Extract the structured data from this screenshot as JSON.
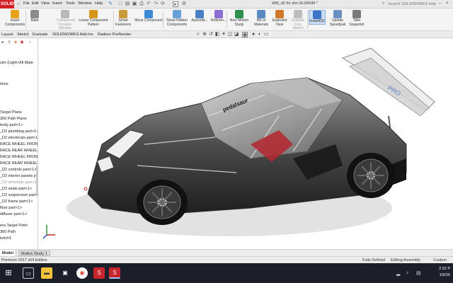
{
  "app": {
    "logo_text": "SOLIDWORKS",
    "document_title": "WM_d2 for sim.SLDASM *",
    "menus": [
      "File",
      "Edit",
      "View",
      "Insert",
      "Tools",
      "Window",
      "Help"
    ],
    "search_placeholder": "Search SOLIDWORKS Help"
  },
  "ribbon": {
    "buttons": [
      {
        "label": "Insert Components",
        "icon": "insert-components-icon",
        "color": "#e8a21a"
      },
      {
        "label": "Mate",
        "icon": "mate-icon",
        "color": "#8a8a8a"
      },
      {
        "label": "Component Preview Window",
        "icon": "preview-window-icon",
        "color": "#b8b8b8",
        "dim": true
      },
      {
        "label": "Linear Component Pattern",
        "icon": "linear-pattern-icon",
        "color": "#d9951a"
      },
      {
        "label": "Smart Fasteners",
        "icon": "smart-fasteners-icon",
        "color": "#c99a3a"
      },
      {
        "label": "Move Component",
        "icon": "move-component-icon",
        "color": "#3a8ad6"
      },
      {
        "label": "Show Hidden Components",
        "icon": "show-hidden-icon",
        "color": "#6aa0d8"
      },
      {
        "label": "Assembl...",
        "icon": "assembly-features-icon",
        "color": "#4a7fc1"
      },
      {
        "label": "Referen...",
        "icon": "reference-geometry-icon",
        "color": "#8a6fd0"
      },
      {
        "label": "New Motion Study",
        "icon": "motion-study-icon",
        "color": "#2f8f4f"
      },
      {
        "label": "Bill of Materials",
        "icon": "bom-icon",
        "color": "#5a8ac0"
      },
      {
        "label": "Exploded View",
        "icon": "exploded-view-icon",
        "color": "#d07a2a"
      },
      {
        "label": "Explode Line Sketch",
        "icon": "explode-line-icon",
        "color": "#bdbdbd",
        "dim": true
      },
      {
        "label": "Instant3D",
        "icon": "instant3d-icon",
        "color": "#3b73c4",
        "active": true
      },
      {
        "label": "Update Speedpak",
        "icon": "speedpak-icon",
        "color": "#6a8fc0"
      },
      {
        "label": "Take Snapshot",
        "icon": "snapshot-icon",
        "color": "#7a7a7a"
      }
    ]
  },
  "tabs": [
    "Layout",
    "Sketch",
    "Evaluate",
    "SOLIDWORKS Add-Ins",
    "Radeon ProRender"
  ],
  "tree": {
    "items": [
      {
        "label": "sim  (Light<All Mate",
        "dim": false
      },
      {
        "label": "tions",
        "dim": false
      },
      {
        "label": "Target Plane",
        "dim": false
      },
      {
        "label": "360 Path Plane",
        "dim": false
      },
      {
        "label": "body part<1>",
        "dim": false
      },
      {
        "label": "_D2 plumbing part<1>",
        "dim": false
      },
      {
        "label": "_D2 electricals part<1>",
        "dim": false
      },
      {
        "label": "RACE WHEEL FRONT",
        "dim": false
      },
      {
        "label": "RACE REAR WHEEL T",
        "dim": false
      },
      {
        "label": "RACE WHEEL FRONT",
        "dim": false
      },
      {
        "label": "RACE REAR WHEEL T",
        "dim": false
      },
      {
        "label": "_D2 controls part<1>",
        "dim": false
      },
      {
        "label": "_D2 interior panels pa",
        "dim": false
      },
      {
        "label": "_D2 drivetrain part<1>",
        "dim": true
      },
      {
        "label": "_D2 seats part<1>",
        "dim": false
      },
      {
        "label": "_D2 suspension part<1>",
        "dim": false
      },
      {
        "label": "_D2 frame part<1>",
        "dim": false
      },
      {
        "label": "floor part<1>",
        "dim": false
      },
      {
        "label": "diffuser part<1>",
        "dim": false
      },
      {
        "label": "era Target Point",
        "dim": false
      },
      {
        "label": "360 Path",
        "dim": false
      },
      {
        "label": "ketch1",
        "dim": false
      }
    ]
  },
  "car": {
    "decal": "pedalsaur",
    "wing_text": "PRO",
    "body_color": "#3a3a3a",
    "accent_color": "#b3262d"
  },
  "bottom_tabs": {
    "model": "Model",
    "motion": "Motion Study 1"
  },
  "status": {
    "edition": "Premium 2017 x64 Edition",
    "defined": "Fully Defined",
    "mode": "Editing Assembly",
    "units": "Custom"
  },
  "taskbar": {
    "time": "2:32 P",
    "date": "1/9/20"
  }
}
